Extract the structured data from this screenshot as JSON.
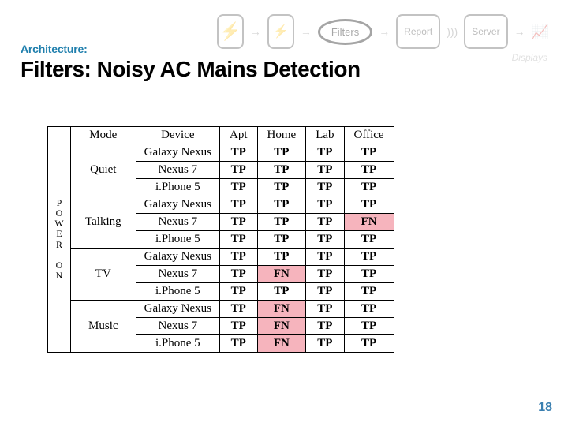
{
  "header": {
    "eyebrow": "Architecture:",
    "title": "Filters: Noisy AC Mains Detection"
  },
  "flow": {
    "filters": "Filters",
    "report": "Report",
    "server": "Server",
    "displays": "Displays"
  },
  "side_label": "P\nO\nW\nE\nR\n\nO\nN",
  "table": {
    "columns": [
      "Mode",
      "Device",
      "Apt",
      "Home",
      "Lab",
      "Office"
    ],
    "groups": [
      {
        "mode": "Quiet",
        "rows": [
          {
            "device": "Galaxy Nexus",
            "cells": [
              "TP",
              "TP",
              "TP",
              "TP"
            ],
            "fn": [
              false,
              false,
              false,
              false
            ]
          },
          {
            "device": "Nexus 7",
            "cells": [
              "TP",
              "TP",
              "TP",
              "TP"
            ],
            "fn": [
              false,
              false,
              false,
              false
            ]
          },
          {
            "device": "i.Phone 5",
            "cells": [
              "TP",
              "TP",
              "TP",
              "TP"
            ],
            "fn": [
              false,
              false,
              false,
              false
            ]
          }
        ]
      },
      {
        "mode": "Talking",
        "rows": [
          {
            "device": "Galaxy Nexus",
            "cells": [
              "TP",
              "TP",
              "TP",
              "TP"
            ],
            "fn": [
              false,
              false,
              false,
              false
            ]
          },
          {
            "device": "Nexus 7",
            "cells": [
              "TP",
              "TP",
              "TP",
              "FN"
            ],
            "fn": [
              false,
              false,
              false,
              true
            ]
          },
          {
            "device": "i.Phone 5",
            "cells": [
              "TP",
              "TP",
              "TP",
              "TP"
            ],
            "fn": [
              false,
              false,
              false,
              false
            ]
          }
        ]
      },
      {
        "mode": "TV",
        "rows": [
          {
            "device": "Galaxy Nexus",
            "cells": [
              "TP",
              "TP",
              "TP",
              "TP"
            ],
            "fn": [
              false,
              false,
              false,
              false
            ]
          },
          {
            "device": "Nexus 7",
            "cells": [
              "TP",
              "FN",
              "TP",
              "TP"
            ],
            "fn": [
              false,
              true,
              false,
              false
            ]
          },
          {
            "device": "i.Phone 5",
            "cells": [
              "TP",
              "TP",
              "TP",
              "TP"
            ],
            "fn": [
              false,
              false,
              false,
              false
            ]
          }
        ]
      },
      {
        "mode": "Music",
        "rows": [
          {
            "device": "Galaxy Nexus",
            "cells": [
              "TP",
              "FN",
              "TP",
              "TP"
            ],
            "fn": [
              false,
              true,
              false,
              false
            ]
          },
          {
            "device": "Nexus 7",
            "cells": [
              "TP",
              "FN",
              "TP",
              "TP"
            ],
            "fn": [
              false,
              true,
              false,
              false
            ]
          },
          {
            "device": "i.Phone 5",
            "cells": [
              "TP",
              "FN",
              "TP",
              "TP"
            ],
            "fn": [
              false,
              true,
              false,
              false
            ]
          }
        ]
      }
    ]
  },
  "page_number": "18"
}
